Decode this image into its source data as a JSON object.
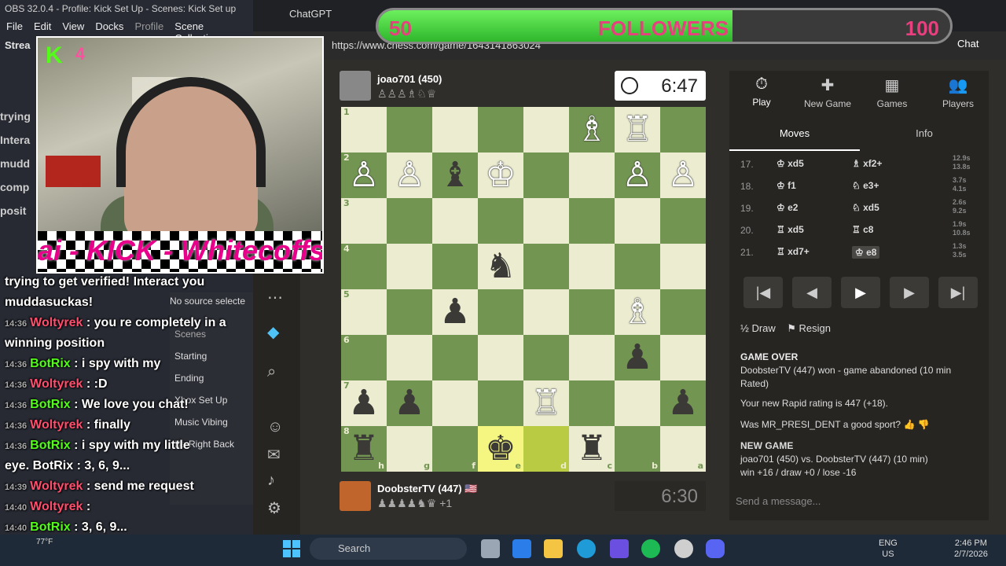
{
  "obs": {
    "title": "OBS 32.0.4 - Profile: Kick Set Up - Scenes: Kick Set up",
    "menu": [
      "File",
      "Edit",
      "View",
      "Docks",
      "Profile",
      "Scene Collection"
    ],
    "stream_label": "Strea",
    "no_source": "No source selecte",
    "scenes_header": "Scenes",
    "scenes": [
      "Starting",
      "Ending",
      "Xbox Set Up",
      "Music Vibing",
      "Be Right Back"
    ],
    "left_chat_fragments": [
      "trying",
      "Intera",
      "mudd",
      "comp",
      "posit"
    ]
  },
  "webcam": {
    "kick_count": "4",
    "banner": "ai - KICK - Whitecoffsk"
  },
  "overlay_chat": [
    {
      "time": "",
      "user": "",
      "text": "trying to get verified! Interact you"
    },
    {
      "time": "",
      "user": "",
      "text": "muddasuckas!"
    },
    {
      "time": "14:36",
      "user": "Woltyrek",
      "text": ": you re completely in a"
    },
    {
      "time": "",
      "user": "",
      "text": "winning position"
    },
    {
      "time": "14:36",
      "user": "BotRix",
      "text": ": i spy with my"
    },
    {
      "time": "14:36",
      "user": "Woltyrek",
      "text": ": :D"
    },
    {
      "time": "14:36",
      "user": "BotRix",
      "text": ": We love you chat!"
    },
    {
      "time": "14:36",
      "user": "Woltyrek",
      "text": ": finally"
    },
    {
      "time": "14:36",
      "user": "BotRix",
      "text": ": i spy with my little"
    },
    {
      "time": "",
      "user": "",
      "text": "eye.   BotRix : 3, 6, 9..."
    },
    {
      "time": "14:39",
      "user": "Woltyrek",
      "text": ": send me request"
    },
    {
      "time": "14:40",
      "user": "Woltyrek",
      "text": ":"
    },
    {
      "time": "14:40",
      "user": "BotRix",
      "text": ": 3, 6, 9..."
    }
  ],
  "browser": {
    "tab_title": "ChatGPT",
    "url": "https://www.chess.com/game/1643141863024",
    "chat_button": "Chat"
  },
  "followers": {
    "start": "50",
    "label": "FOLLOWERS",
    "end": "100",
    "progress": 0.62
  },
  "chess": {
    "opponent": {
      "name": "joao701 (450)",
      "captured": "♙♙♙♗♘♕"
    },
    "opponent_clock": "6:47",
    "player": {
      "name": "DoobsterTV (447) 🇺🇸",
      "captured": "♟♟♟♟♞♛ +1"
    },
    "player_clock": "6:30",
    "board": [
      [
        "",
        "",
        "",
        "",
        "",
        "♗",
        "♖",
        ""
      ],
      [
        "♙",
        "♙",
        "♝",
        "♔",
        "",
        "",
        "♙",
        "♙"
      ],
      [
        "",
        "",
        "",
        "",
        "",
        "",
        "",
        ""
      ],
      [
        "",
        "",
        "",
        "♞",
        "",
        "",
        "",
        ""
      ],
      [
        "",
        "",
        "♟",
        "",
        "",
        "",
        "♗",
        ""
      ],
      [
        "",
        "",
        "",
        "",
        "",
        "",
        "♟",
        ""
      ],
      [
        "♟",
        "♟",
        "",
        "",
        "♖",
        "",
        "",
        "♟"
      ],
      [
        "♜",
        "",
        "",
        "♚",
        "",
        "♜",
        "",
        ""
      ]
    ],
    "ranks": [
      "1",
      "2",
      "3",
      "4",
      "5",
      "6",
      "7",
      "8"
    ],
    "files": [
      "h",
      "g",
      "f",
      "e",
      "d",
      "c",
      "b",
      "a"
    ],
    "highlight": [
      [
        7,
        3
      ],
      [
        7,
        4
      ]
    ]
  },
  "panel": {
    "nav": [
      {
        "icon": "⏱",
        "label": "Play"
      },
      {
        "icon": "✚",
        "label": "New Game"
      },
      {
        "icon": "▦",
        "label": "Games"
      },
      {
        "icon": "👥",
        "label": "Players"
      }
    ],
    "tabs": [
      "Moves",
      "Info"
    ],
    "moves": [
      {
        "n": "17.",
        "w": "♔ xd5",
        "b": "♗ xf2+",
        "t": "12.9s\n13.8s"
      },
      {
        "n": "18.",
        "w": "♔ f1",
        "b": "♘ e3+",
        "t": "3.7s\n4.1s"
      },
      {
        "n": "19.",
        "w": "♔ e2",
        "b": "♘ xd5",
        "t": "2.6s\n9.2s"
      },
      {
        "n": "20.",
        "w": "♖ xd5",
        "b": "♖ c8",
        "t": "1.9s\n10.8s"
      },
      {
        "n": "21.",
        "w": "♖ xd7+",
        "b": "♔ e8",
        "t": "1.3s\n3.5s"
      }
    ],
    "draw": "Draw",
    "resign": "Resign",
    "gameover_title": "GAME OVER",
    "gameover_text": "DoobsterTV (447) won - game abandoned (10 min Rated)",
    "rating_text": "Your new Rapid rating is 447 (+18).",
    "sport_question": "Was MR_PRESI_DENT a good sport?",
    "newgame_title": "NEW GAME",
    "newgame_text": "joao701 (450) vs. DoobsterTV (447) (10 min)",
    "odds_text": "win +16 / draw +0 / lose -16",
    "message_placeholder": "Send a message..."
  },
  "taskbar": {
    "search": "Search",
    "temperature": "77°F",
    "lang1": "ENG",
    "lang2": "US",
    "time": "2:46 PM",
    "date": "2/7/2026"
  }
}
